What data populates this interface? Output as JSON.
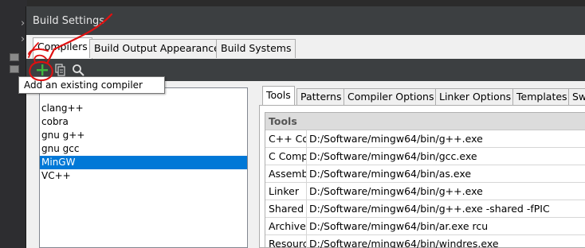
{
  "window": {
    "title": "Build Settings"
  },
  "top_tabs": [
    {
      "label": "Compilers",
      "active": true
    },
    {
      "label": "Build Output Appearance",
      "active": false
    },
    {
      "label": "Build Systems",
      "active": false
    }
  ],
  "toolbar": {
    "add_icon": "plus-icon",
    "copy_icon": "copy-icon",
    "search_icon": "search-icon",
    "tooltip": "Add an existing compiler"
  },
  "compilers": [
    {
      "name": "clang++",
      "selected": false
    },
    {
      "name": "cobra",
      "selected": false
    },
    {
      "name": "gnu g++",
      "selected": false
    },
    {
      "name": "gnu gcc",
      "selected": false
    },
    {
      "name": "MinGW",
      "selected": true
    },
    {
      "name": "VC++",
      "selected": false
    }
  ],
  "inner_tabs": [
    {
      "label": "Tools",
      "active": true
    },
    {
      "label": "Patterns",
      "active": false
    },
    {
      "label": "Compiler Options",
      "active": false
    },
    {
      "label": "Linker Options",
      "active": false
    },
    {
      "label": "Templates",
      "active": false
    },
    {
      "label": "Sw",
      "active": false
    }
  ],
  "tools": {
    "header": "Tools",
    "rows": [
      {
        "name": "C++ Compiler",
        "value": "D:/Software/mingw64/bin/g++.exe"
      },
      {
        "name": "C Compiler",
        "value": "D:/Software/mingw64/bin/gcc.exe"
      },
      {
        "name": "Assembler",
        "value": "D:/Software/mingw64/bin/as.exe"
      },
      {
        "name": "Linker",
        "value": "D:/Software/mingw64/bin/g++.exe"
      },
      {
        "name": "Shared Object",
        "value": "D:/Software/mingw64/bin/g++.exe -shared -fPIC"
      },
      {
        "name": "Archive",
        "value": "D:/Software/mingw64/bin/ar.exe rcu"
      },
      {
        "name": "Resource Compiler",
        "value": "D:/Software/mingw64/bin/windres.exe"
      }
    ]
  },
  "colors": {
    "selection": "#0078d7",
    "annotation": "#e01010",
    "titlebar": "#3c3f41"
  }
}
